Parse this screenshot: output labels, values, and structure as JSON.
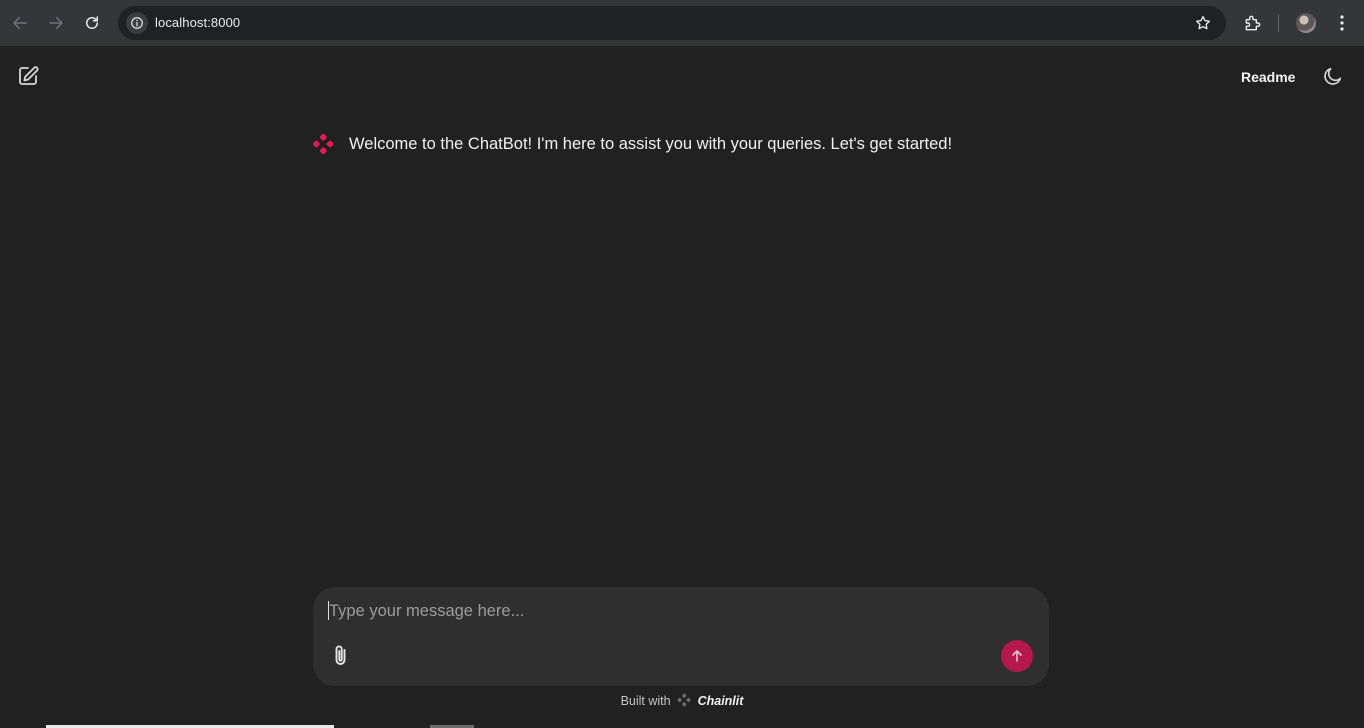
{
  "browser": {
    "url": "localhost:8000",
    "icons": [
      "back-icon",
      "forward-icon",
      "reload-icon",
      "site-info-icon",
      "bookmark-star-icon",
      "extensions-icon",
      "profile-avatar",
      "browser-menu-icon"
    ]
  },
  "header": {
    "readme_label": "Readme",
    "icons": [
      "new-chat-icon",
      "moon-icon"
    ]
  },
  "messages": [
    {
      "author": "assistant",
      "text": "Welcome to the ChatBot! I'm here to assist you with your queries. Let's get started!"
    }
  ],
  "composer": {
    "placeholder": "Type your message here...",
    "value": "",
    "icons": [
      "paperclip-icon",
      "arrow-up-icon"
    ]
  },
  "footer": {
    "prefix": "Built with",
    "brand": "Chainlit"
  },
  "colors": {
    "background": "#212121",
    "accent": "#b5184d",
    "avatar_pink": "#f0145a"
  }
}
